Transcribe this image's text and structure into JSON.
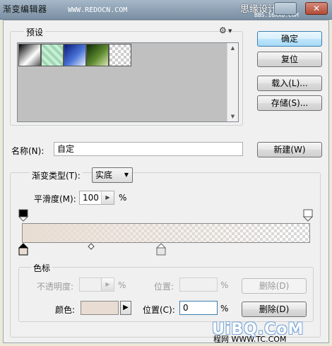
{
  "window": {
    "title": "渐变编辑器",
    "url_overlay": "WWW.REDOCN.COM",
    "site_overlay": "思缘设计论坛",
    "site_url_overlay": "BBS.16XX8.COM"
  },
  "presets": {
    "label": "预设",
    "gear_glyph": "⚙",
    "swatches": [
      "black-white",
      "green-pattern",
      "blue-white",
      "green-white",
      "transparent"
    ]
  },
  "buttons": {
    "ok": "确定",
    "reset": "复位",
    "load": "载入(L)...",
    "save": "存储(S)...",
    "new": "新建(W)"
  },
  "name": {
    "label": "名称(N):",
    "value": "自定"
  },
  "gradient": {
    "type_label": "渐变类型(T):",
    "type_value": "实底",
    "smoothness_label": "平滑度(M):",
    "smoothness_value": "100",
    "percent": "%",
    "color_stop_color": "#e9ddd3"
  },
  "stops": {
    "label": "色标",
    "opacity_label": "不透明度:",
    "opacity_value": "",
    "opacity_percent": "%",
    "opacity_position_label": "位置:",
    "opacity_position_value": "",
    "opacity_position_percent": "%",
    "opacity_delete": "删除(D)",
    "color_label": "颜色:",
    "color_position_label": "位置(C):",
    "color_position_value": "0",
    "color_position_percent": "%",
    "color_delete": "删除(D)"
  },
  "footer": {
    "watermark": "UiBQ.CoM",
    "small_text": "程网 WWW.TC.COM"
  }
}
